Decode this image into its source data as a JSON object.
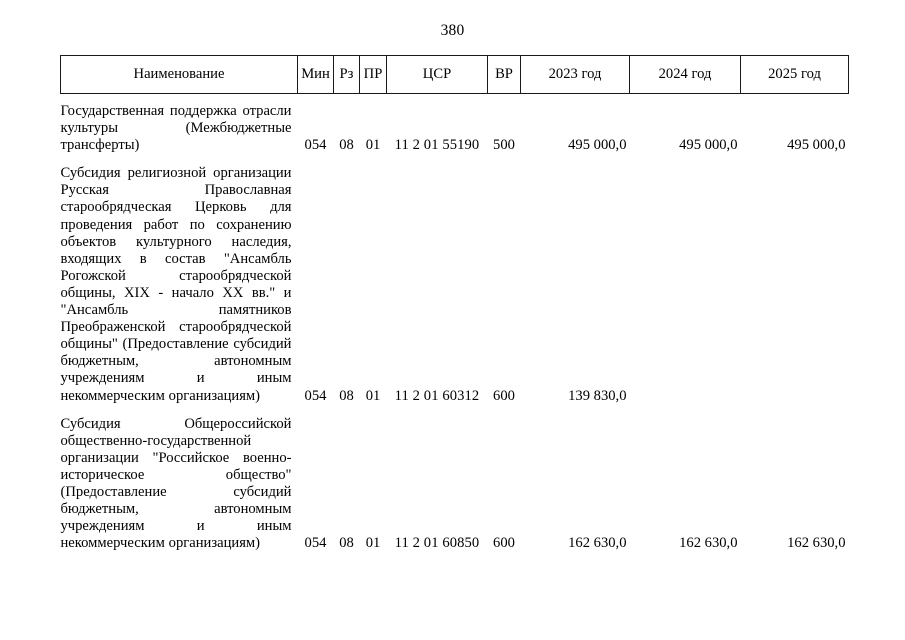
{
  "document": {
    "page_number": "380",
    "language": "ru"
  },
  "table": {
    "headers": [
      {
        "key": "name",
        "label": "Наименование"
      },
      {
        "key": "min",
        "label": "Мин"
      },
      {
        "key": "rz",
        "label": "Рз"
      },
      {
        "key": "pr",
        "label": "ПР"
      },
      {
        "key": "csr",
        "label": "ЦСР"
      },
      {
        "key": "vr",
        "label": "ВР"
      },
      {
        "key": "y2023",
        "label": "2023 год"
      },
      {
        "key": "y2024",
        "label": "2024 год"
      },
      {
        "key": "y2025",
        "label": "2025 год"
      }
    ],
    "rows": [
      {
        "name": "Государственная поддержка отрасли культуры (Межбюджетные трансферты)",
        "min": "054",
        "rz": "08",
        "pr": "01",
        "csr": "11 2 01 55190",
        "vr": "500",
        "y2023": "495 000,0",
        "y2024": "495 000,0",
        "y2025": "495 000,0"
      },
      {
        "name": "Субсидия религиозной организации Русская Православная старообрядческая Церковь для проведения работ по сохранению объектов культурного наследия, входящих в состав \"Ансамбль Рогожской старообрядческой общины, XIX - начало XX вв.\" и \"Ансамбль памятников Преображенской старообрядческой общины\" (Предоставление субсидий бюджетным, автономным учреждениям и иным некоммерческим организациям)",
        "min": "054",
        "rz": "08",
        "pr": "01",
        "csr": "11 2 01 60312",
        "vr": "600",
        "y2023": "139 830,0",
        "y2024": "",
        "y2025": ""
      },
      {
        "name": "Субсидия Общероссийской общественно-государственной организации \"Российское военно-историческое общество\" (Предоставление субсидий бюджетным, автономным учреждениям и иным некоммерческим организациям)",
        "min": "054",
        "rz": "08",
        "pr": "01",
        "csr": "11 2 01 60850",
        "vr": "600",
        "y2023": "162 630,0",
        "y2024": "162 630,0",
        "y2025": "162 630,0"
      }
    ]
  },
  "colors": {
    "text": "#000000",
    "border": "#1a1a1a",
    "background": "#ffffff"
  }
}
